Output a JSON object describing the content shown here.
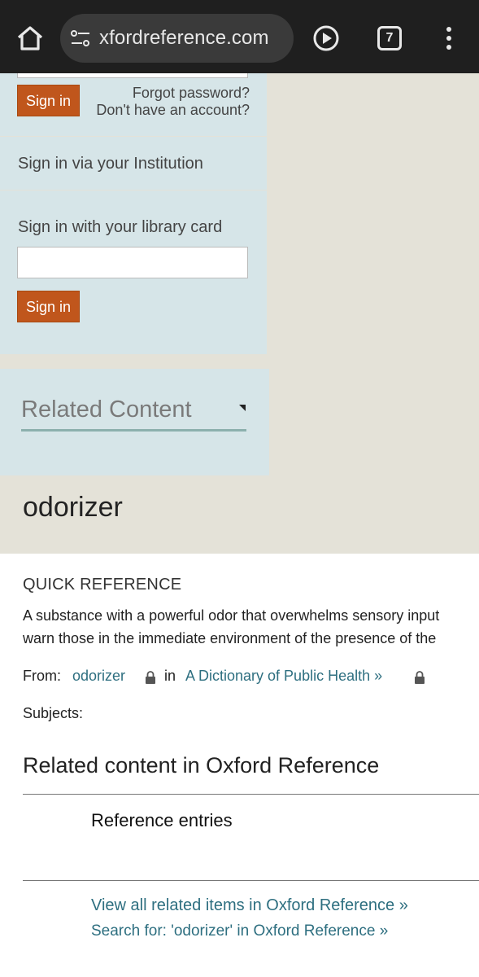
{
  "browser": {
    "url": "xfordreference.com",
    "tab_count": "7"
  },
  "signin": {
    "button_label": "Sign in",
    "forgot_password": "Forgot password?",
    "no_account": "Don't have an account?",
    "institution": "Sign in via your Institution",
    "library_card_label": "Sign in with your library card",
    "library_button_label": "Sign in"
  },
  "related_panel": {
    "label": "Related Content"
  },
  "entry": {
    "headword": "odorizer",
    "section": "QUICK REFERENCE",
    "definition_line1": "A substance with a powerful odor that overwhelms sensory input",
    "definition_line2": "warn those in the immediate environment of the presence of the",
    "from_label": "From:",
    "from_link": "odorizer",
    "in_word": "in",
    "dictionary_link": "A Dictionary of Public Health »",
    "subjects_label": "Subjects:"
  },
  "related": {
    "heading": "Related content in Oxford Reference",
    "reference_entries": "Reference entries",
    "view_all": "View all related items in Oxford Reference »",
    "search_for": "Search for: 'odorizer' in Oxford Reference »"
  }
}
